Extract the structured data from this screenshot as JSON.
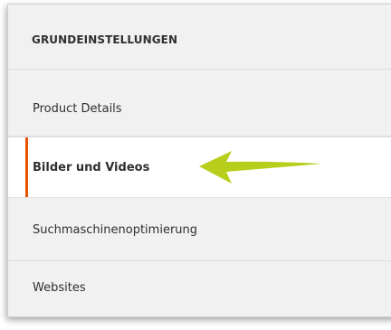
{
  "panel": {
    "section_title": "GRUNDEINSTELLUNGEN",
    "items": [
      {
        "label": "Product Details"
      },
      {
        "label": "Bilder und Videos",
        "active": true
      },
      {
        "label": "Suchmaschinenoptimierung"
      },
      {
        "label": "Websites"
      }
    ]
  },
  "colors": {
    "active_accent": "#eb5202",
    "arrow": "#b7cf1c",
    "panel_background": "#f1f1f1"
  },
  "annotation": {
    "icon": "pointer-arrow-icon"
  }
}
